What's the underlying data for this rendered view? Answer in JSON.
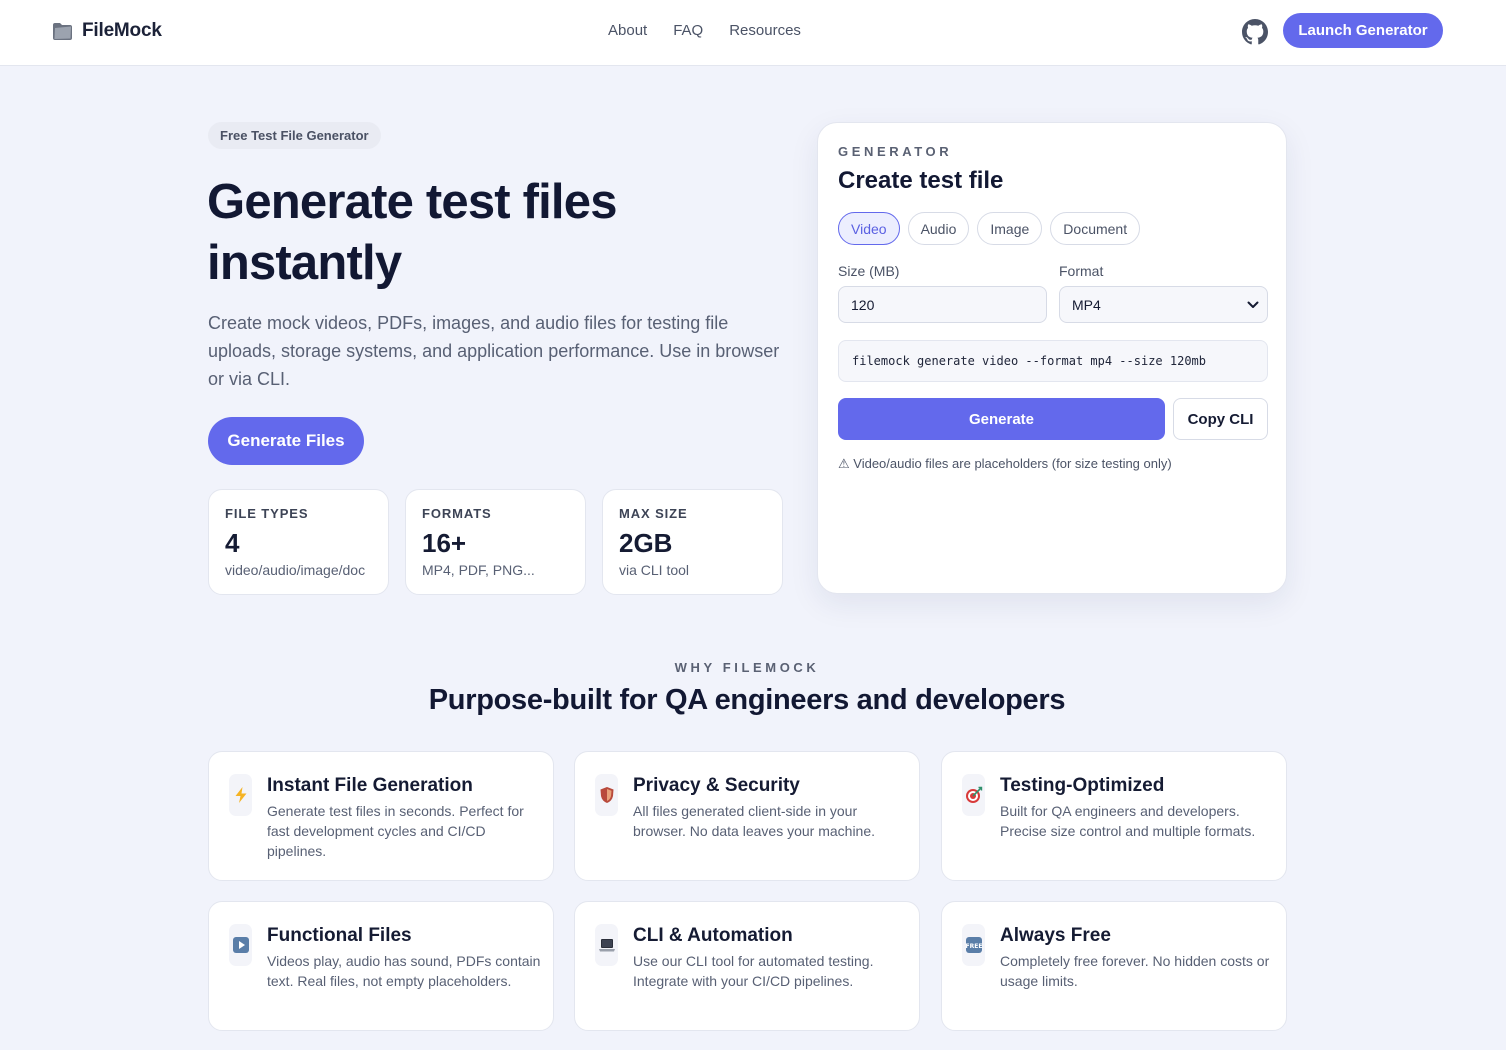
{
  "nav": {
    "brand": "FileMock",
    "links": [
      "About",
      "FAQ",
      "Resources"
    ],
    "cta_label": "Launch Generator",
    "github_icon": "github-icon"
  },
  "hero": {
    "badge": "Free Test File Generator",
    "title": "Generate test files instantly",
    "description": "Create mock videos, PDFs, images, and audio files for testing file uploads, storage systems, and application performance. Use in browser or via CLI.",
    "cta_label": "Generate Files",
    "stats": [
      {
        "label": "FILE TYPES",
        "value": "4",
        "sub": "video/audio/image/doc"
      },
      {
        "label": "FORMATS",
        "value": "16+",
        "sub": "MP4, PDF, PNG..."
      },
      {
        "label": "MAX SIZE",
        "value": "2GB",
        "sub": "via CLI tool"
      }
    ]
  },
  "generator": {
    "eyebrow": "GENERATOR",
    "title": "Create test file",
    "tabs": [
      "Video",
      "Audio",
      "Image",
      "Document"
    ],
    "active_tab": "Video",
    "size_label": "Size (MB)",
    "size_value": "120",
    "format_label": "Format",
    "format_value": "MP4",
    "cli_command": "filemock generate video --format mp4 --size 120mb",
    "generate_label": "Generate",
    "copy_label": "Copy CLI",
    "note": "⚠ Video/audio files are placeholders (for size testing only)"
  },
  "why": {
    "eyebrow": "WHY FILEMOCK",
    "title": "Purpose-built for QA engineers and developers",
    "features": [
      {
        "icon": "lightning-icon",
        "title": "Instant File Generation",
        "desc": "Generate test files in seconds. Perfect for fast development cycles and CI/CD pipelines."
      },
      {
        "icon": "shield-icon",
        "title": "Privacy & Security",
        "desc": "All files generated client-side in your browser. No data leaves your machine."
      },
      {
        "icon": "target-icon",
        "title": "Testing-Optimized",
        "desc": "Built for QA engineers and developers. Precise size control and multiple formats."
      },
      {
        "icon": "play-icon",
        "title": "Functional Files",
        "desc": "Videos play, audio has sound, PDFs contain text. Real files, not empty placeholders."
      },
      {
        "icon": "laptop-icon",
        "title": "CLI & Automation",
        "desc": "Use our CLI tool for automated testing. Integrate with your CI/CD pipelines."
      },
      {
        "icon": "free-icon",
        "title": "Always Free",
        "desc": "Completely free forever. No hidden costs or usage limits."
      }
    ]
  },
  "colors": {
    "accent": "#6369ec",
    "background": "#f1f3fb",
    "text": "#151b33"
  }
}
